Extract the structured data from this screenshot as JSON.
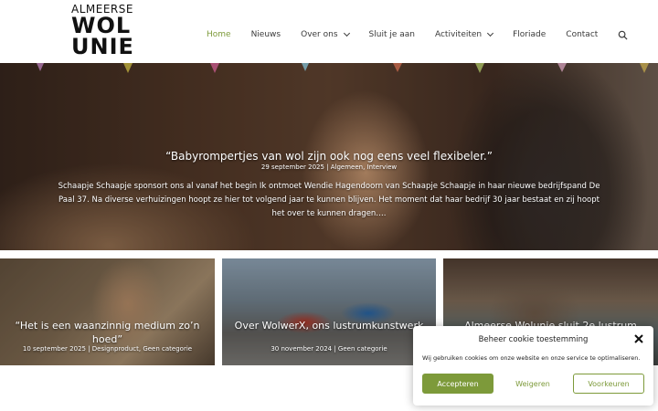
{
  "logo": {
    "line1": "ALMEERSE",
    "line2": "WOL",
    "line3": "UNIE"
  },
  "nav": {
    "items": [
      {
        "label": "Home"
      },
      {
        "label": "Nieuws"
      },
      {
        "label": "Over ons"
      },
      {
        "label": "Sluit je aan"
      },
      {
        "label": "Activiteiten"
      },
      {
        "label": "Floriade"
      },
      {
        "label": "Contact"
      }
    ]
  },
  "hero": {
    "title": "“Babyrompertjes van wol zijn ook nog eens veel flexibeler.”",
    "meta": "29 september 2025 | Algemeen, Interview",
    "excerpt": "Schaapje Schaapje sponsort ons al vanaf het begin Ik ontmoet Wendie Hagendoorn van Schaapje Schaapje in haar nieuwe bedrijfspand De Paal 37. Na diverse verhuizingen hoopt ze hier tot volgend jaar te kunnen blijven. Het moment dat haar bedrijf 30 jaar bestaat en zij hoopt het over te kunnen dragen…."
  },
  "cards": [
    {
      "title": "“Het is een waanzinnig medium zo’n hoed”",
      "meta": "10 september 2025 | Designproduct, Geen categorie"
    },
    {
      "title": "Over WolwerX, ons lustrumkunstwerk",
      "meta": "30 november 2024 | Geen categorie"
    },
    {
      "title": "Almeerse Wolunie sluit 2e lustrum",
      "meta": ""
    }
  ],
  "cookie": {
    "title": "Beheer cookie toestemming",
    "text": "Wij gebruiken cookies om onze website en onze service te optimaliseren.",
    "accept": "Accepteren",
    "deny": "Weigeren",
    "prefs": "Voorkeuren"
  },
  "colors": {
    "accent": "#7d9a3a",
    "nav_text": "#3a3a3a"
  }
}
